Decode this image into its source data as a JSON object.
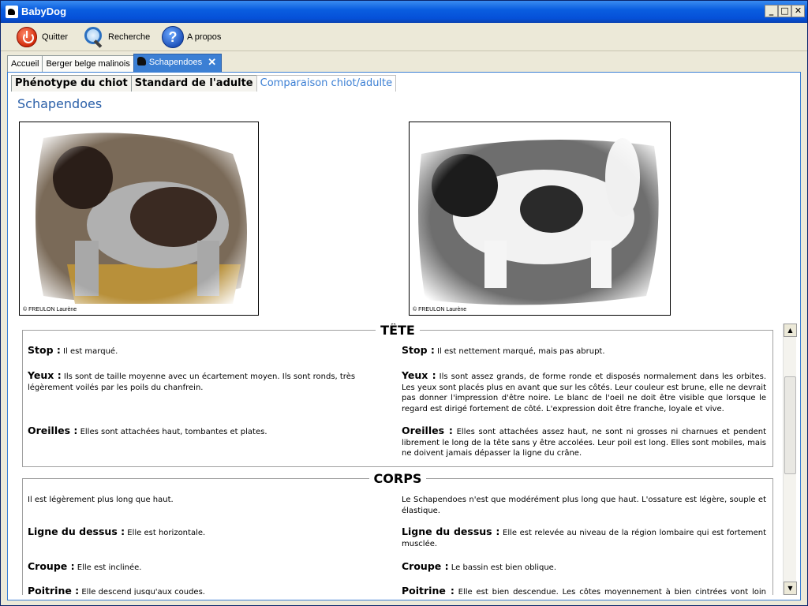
{
  "window": {
    "title": "BabyDog"
  },
  "toolbar": {
    "quit_label": "Quitter",
    "search_label": "Recherche",
    "about_label": "A propos"
  },
  "top_tabs": [
    {
      "label": "Accueil"
    },
    {
      "label": "Berger belge malinois"
    },
    {
      "label": "Schapendoes",
      "active": true
    }
  ],
  "sub_tabs": [
    {
      "label": "Phénotype du chiot"
    },
    {
      "label": "Standard de l'adulte"
    },
    {
      "label": "Comparaison chiot/adulte",
      "active": true
    }
  ],
  "breed_title": "Schapendoes",
  "photos": {
    "puppy_credit": "© FREULON Laurène",
    "adult_credit": "© FREULON Laurène"
  },
  "sections": [
    {
      "title": "TÊTE",
      "rows": [
        {
          "left_label": "Stop :",
          "left_text": " Il est marqué.",
          "right_label": "Stop :",
          "right_text": " Il est nettement marqué, mais pas abrupt."
        },
        {
          "left_label": "Yeux :",
          "left_text": " Ils sont de taille moyenne avec un écartement moyen. Ils sont ronds, très légèrement voilés par les poils du chanfrein.",
          "right_label": "Yeux :",
          "right_text": " Ils sont assez grands, de forme ronde et disposés normalement dans les orbites. Les yeux sont placés plus en avant que sur les côtés. Leur couleur est brune, elle ne devrait pas donner l'impression d'être noire. Le blanc de l'oeil ne doit être visible que lorsque le regard est dirigé fortement de côté. L'expression doit être franche, loyale et vive."
        },
        {
          "left_label": "Oreilles :",
          "left_text": " Elles sont attachées haut, tombantes et plates.",
          "right_label": "Oreilles :",
          "right_text": " Elles sont attachées assez haut, ne sont ni grosses ni charnues et pendent librement le long de la tête sans y être accolées. Leur poil est long. Elles sont mobiles, mais ne doivent jamais dépasser la ligne du crâne."
        }
      ]
    },
    {
      "title": "CORPS",
      "rows": [
        {
          "left_label": "",
          "left_text": "Il est légèrement plus long que haut.",
          "right_label": "",
          "right_text": "Le Schapendoes n'est que modérément plus long que haut. L'ossature est légère, souple et élastique."
        },
        {
          "left_label": "Ligne du dessus :",
          "left_text": " Elle est horizontale.",
          "right_label": "Ligne du dessus :",
          "right_text": " Elle est relevée au niveau de la région lombaire qui est fortement musclée."
        },
        {
          "left_label": "Croupe :",
          "left_text": " Elle est inclinée.",
          "right_label": "Croupe :",
          "right_text": " Le bassin est bien oblique."
        },
        {
          "left_label": "Poitrine :",
          "left_text": " Elle descend jusqu'aux coudes.",
          "right_label": "Poitrine :",
          "right_text": " Elle est bien descendue. Les côtes moyennement à bien cintrées vont loin vers"
        }
      ]
    }
  ]
}
